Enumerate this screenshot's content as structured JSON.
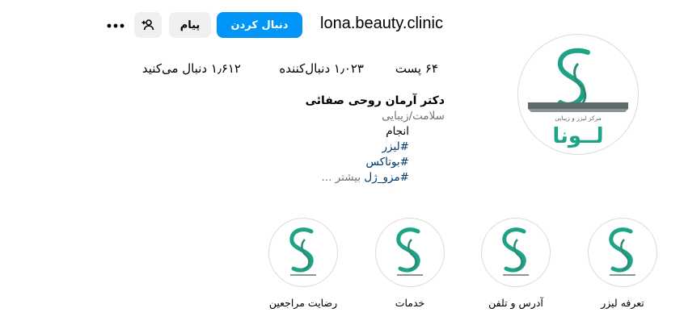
{
  "header": {
    "username": "lona.beauty.clinic",
    "follow_label": "دنبال کردن",
    "message_label": "پیام",
    "add_user_icon": "add-person-icon",
    "more_icon": "ellipsis-icon"
  },
  "avatar": {
    "logo_brand": "لــونا",
    "logo_tagline": "مرکز لیزر و زیبایی"
  },
  "stats": {
    "posts": "۶۴ پست",
    "followers": "۱٫۰۲۳ دنبال‌کننده",
    "following": "۱٫۶۱۲ دنبال می‌کنید"
  },
  "bio": {
    "name": "دکتر آرمان روحی صفائی",
    "category": "سلامت/زیبایی",
    "line1": "انجام",
    "hashtag1": "#لیزر",
    "hashtag2": "#بوتاکس",
    "hashtag3": "#مزو_ژل",
    "more": "بیشتر ..."
  },
  "highlights": [
    {
      "label": "تعرفه لیزر"
    },
    {
      "label": "آدرس و تلفن"
    },
    {
      "label": "خدمات"
    },
    {
      "label": "رضایت مراجعین"
    }
  ],
  "colors": {
    "accent": "#0095f6",
    "brand_teal": "#1fa386",
    "brand_dark": "#2b8a75"
  }
}
